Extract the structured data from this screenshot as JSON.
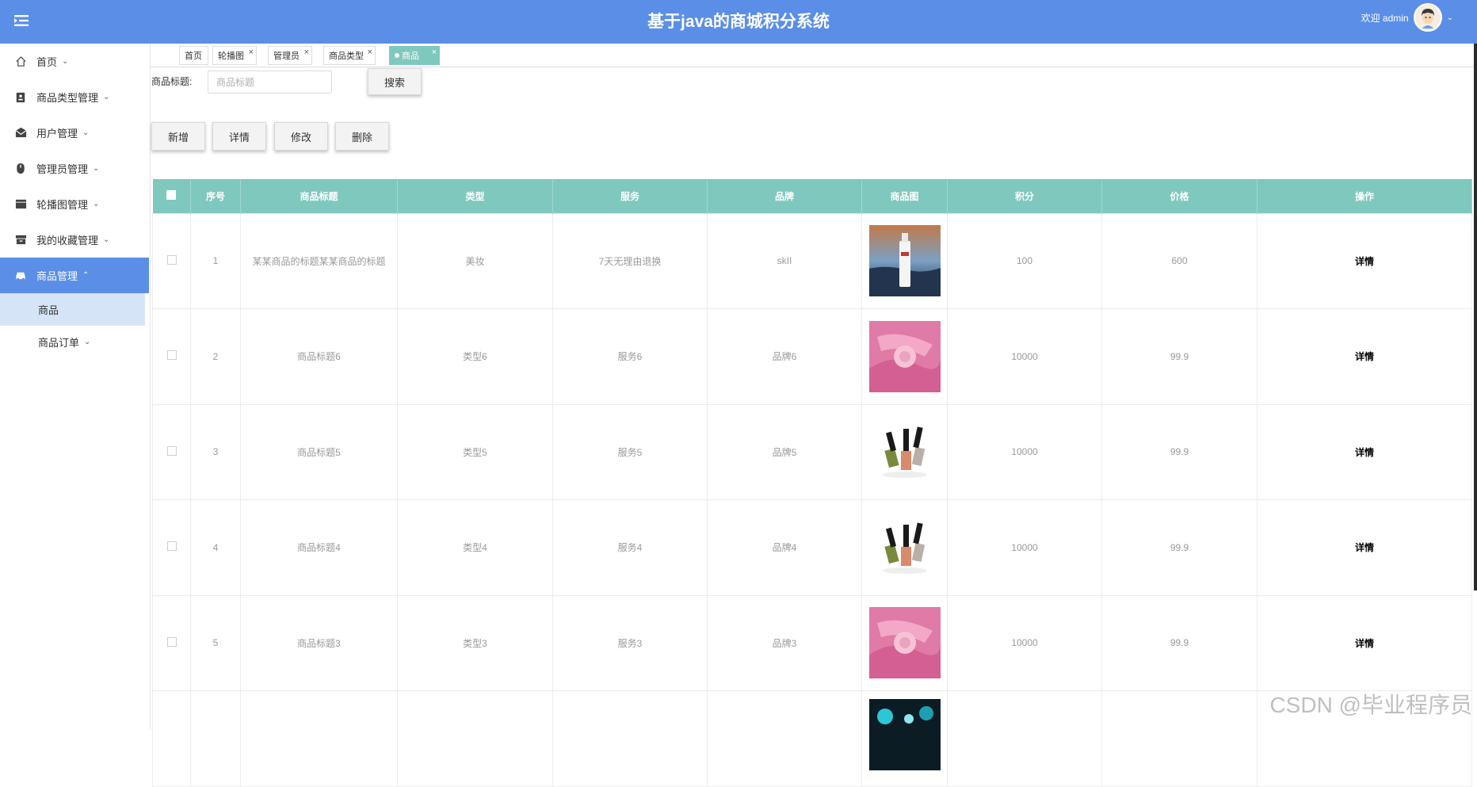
{
  "header": {
    "title": "基于java的商城积分系统",
    "welcome": "欢迎 admin",
    "avatar_icon": "user-avatar-icon",
    "bg_color": "#5B8EE6"
  },
  "sidebar": {
    "items": [
      {
        "label": "首页",
        "icon": "home-icon"
      },
      {
        "label": "商品类型管理",
        "icon": "category-icon"
      },
      {
        "label": "用户管理",
        "icon": "mail-icon"
      },
      {
        "label": "管理员管理",
        "icon": "mouse-icon"
      },
      {
        "label": "轮播图管理",
        "icon": "banner-icon"
      },
      {
        "label": "我的收藏管理",
        "icon": "box-icon"
      },
      {
        "label": "商品管理",
        "icon": "car-icon"
      }
    ],
    "sub_items": [
      {
        "label": "商品"
      },
      {
        "label": "商品订单"
      }
    ]
  },
  "tabs": [
    {
      "label": "首页"
    },
    {
      "label": "轮播图"
    },
    {
      "label": "管理员"
    },
    {
      "label": "商品类型"
    },
    {
      "label": "商品"
    }
  ],
  "search": {
    "label": "商品标题:",
    "placeholder": "商品标题",
    "button": "搜索"
  },
  "actions": {
    "add": "新增",
    "detail": "详情",
    "edit": "修改",
    "delete": "删除"
  },
  "table": {
    "header_color": "#7FC8BD",
    "columns": [
      "序号",
      "商品标题",
      "类型",
      "服务",
      "品牌",
      "商品图",
      "积分",
      "价格",
      "操作"
    ],
    "rows": [
      {
        "no": "1",
        "title": "某某商品的标题某某商品的标题",
        "type": "美妆",
        "service": "7天无理由退换",
        "brand": "skII",
        "image": "skii-bottle",
        "points": "100",
        "price": "600",
        "op": "详情"
      },
      {
        "no": "2",
        "title": "商品标题6",
        "type": "类型6",
        "service": "服务6",
        "brand": "品牌6",
        "image": "pink-cosmetic",
        "points": "10000",
        "price": "99.9",
        "op": "详情"
      },
      {
        "no": "3",
        "title": "商品标题5",
        "type": "类型5",
        "service": "服务5",
        "brand": "品牌5",
        "image": "nail-polish",
        "points": "10000",
        "price": "99.9",
        "op": "详情"
      },
      {
        "no": "4",
        "title": "商品标题4",
        "type": "类型4",
        "service": "服务4",
        "brand": "品牌4",
        "image": "nail-polish",
        "points": "10000",
        "price": "99.9",
        "op": "详情"
      },
      {
        "no": "5",
        "title": "商品标题3",
        "type": "类型3",
        "service": "服务3",
        "brand": "品牌3",
        "image": "pink-cosmetic",
        "points": "10000",
        "price": "99.9",
        "op": "详情"
      },
      {
        "no": "",
        "title": "",
        "type": "",
        "service": "",
        "brand": "",
        "image": "teal-light",
        "points": "",
        "price": "",
        "op": ""
      }
    ]
  },
  "watermark": "CSDN @毕业程序员"
}
